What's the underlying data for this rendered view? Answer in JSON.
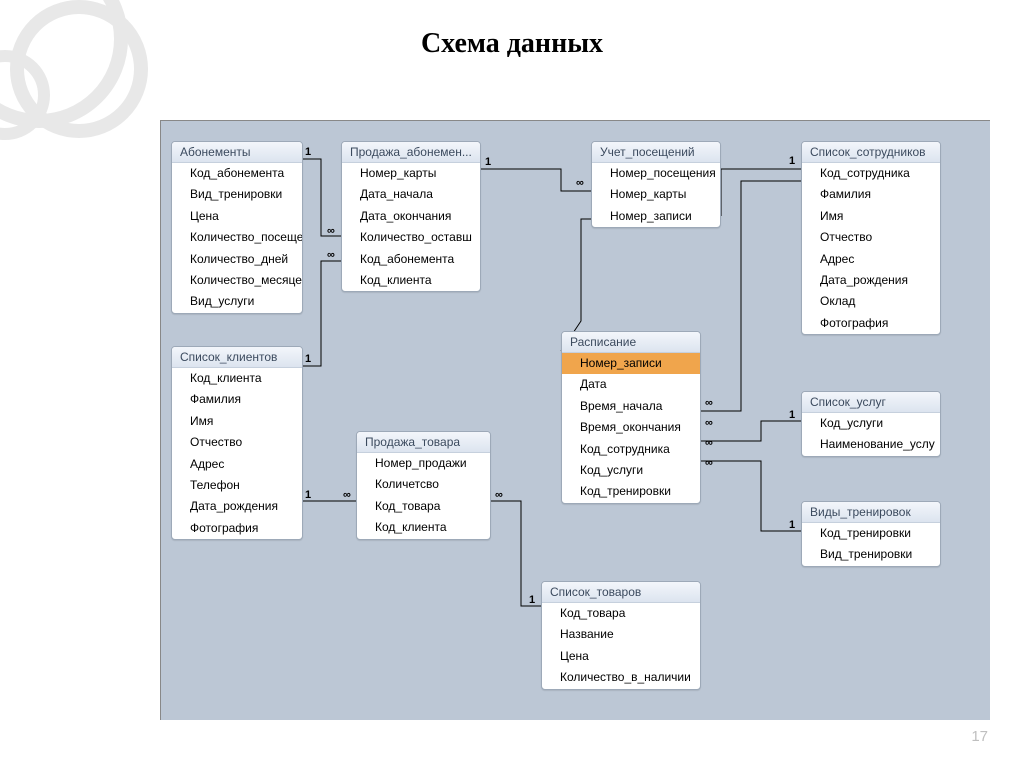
{
  "page": {
    "title": "Схема данных",
    "number": "17"
  },
  "infinity_symbol": "∞",
  "tables": {
    "abonementy": {
      "title": "Абонементы",
      "fields": [
        "Код_абонемента",
        "Вид_тренировки",
        "Цена",
        "Количество_посеще",
        "Количество_дней",
        "Количество_месяце",
        "Вид_услуги"
      ]
    },
    "prodazha_abon": {
      "title": "Продажа_абонемен...",
      "fields": [
        "Номер_карты",
        "Дата_начала",
        "Дата_окончания",
        "Количество_оставш",
        "Код_абонемента",
        "Код_клиента"
      ]
    },
    "uchet": {
      "title": "Учет_посещений",
      "fields": [
        "Номер_посещения",
        "Номер_карты",
        "Номер_записи"
      ]
    },
    "sotrudniki": {
      "title": "Список_сотрудников",
      "fields": [
        "Код_сотрудника",
        "Фамилия",
        "Имя",
        "Отчество",
        "Адрес",
        "Дата_рождения",
        "Оклад",
        "Фотография"
      ]
    },
    "klienty": {
      "title": "Список_клиентов",
      "fields": [
        "Код_клиента",
        "Фамилия",
        "Имя",
        "Отчество",
        "Адрес",
        "Телефон",
        "Дата_рождения",
        "Фотография"
      ]
    },
    "prodazha_tov": {
      "title": "Продажа_товара",
      "fields": [
        "Номер_продажи",
        "Количетсво",
        "Код_товара",
        "Код_клиента"
      ]
    },
    "raspisanie": {
      "title": "Расписание",
      "fields": [
        "Номер_записи",
        "Дата",
        "Время_начала",
        "Время_окончания",
        "Код_сотрудника",
        "Код_услуги",
        "Код_тренировки"
      ]
    },
    "uslugi": {
      "title": "Список_услуг",
      "fields": [
        "Код_услуги",
        "Наименование_услу"
      ]
    },
    "trenirovki": {
      "title": "Виды_тренировок",
      "fields": [
        "Код_тренировки",
        "Вид_тренировки"
      ]
    },
    "tovary": {
      "title": "Список_товаров",
      "fields": [
        "Код_товара",
        "Название",
        "Цена",
        "Количество_в_наличии"
      ]
    }
  },
  "relations": [
    {
      "label_a": "1",
      "label_b": "∞"
    },
    {
      "label_a": "1",
      "label_b": "∞"
    },
    {
      "label_a": "1",
      "label_b": "∞"
    },
    {
      "label_a": "1",
      "label_b": "∞"
    },
    {
      "label_a": "1",
      "label_b": "∞"
    },
    {
      "label_a": "1",
      "label_b": "∞"
    },
    {
      "label_a": "1",
      "label_b": "∞"
    },
    {
      "label_a": "1",
      "label_b": "∞"
    },
    {
      "label_a": "1",
      "label_b": "∞"
    }
  ]
}
